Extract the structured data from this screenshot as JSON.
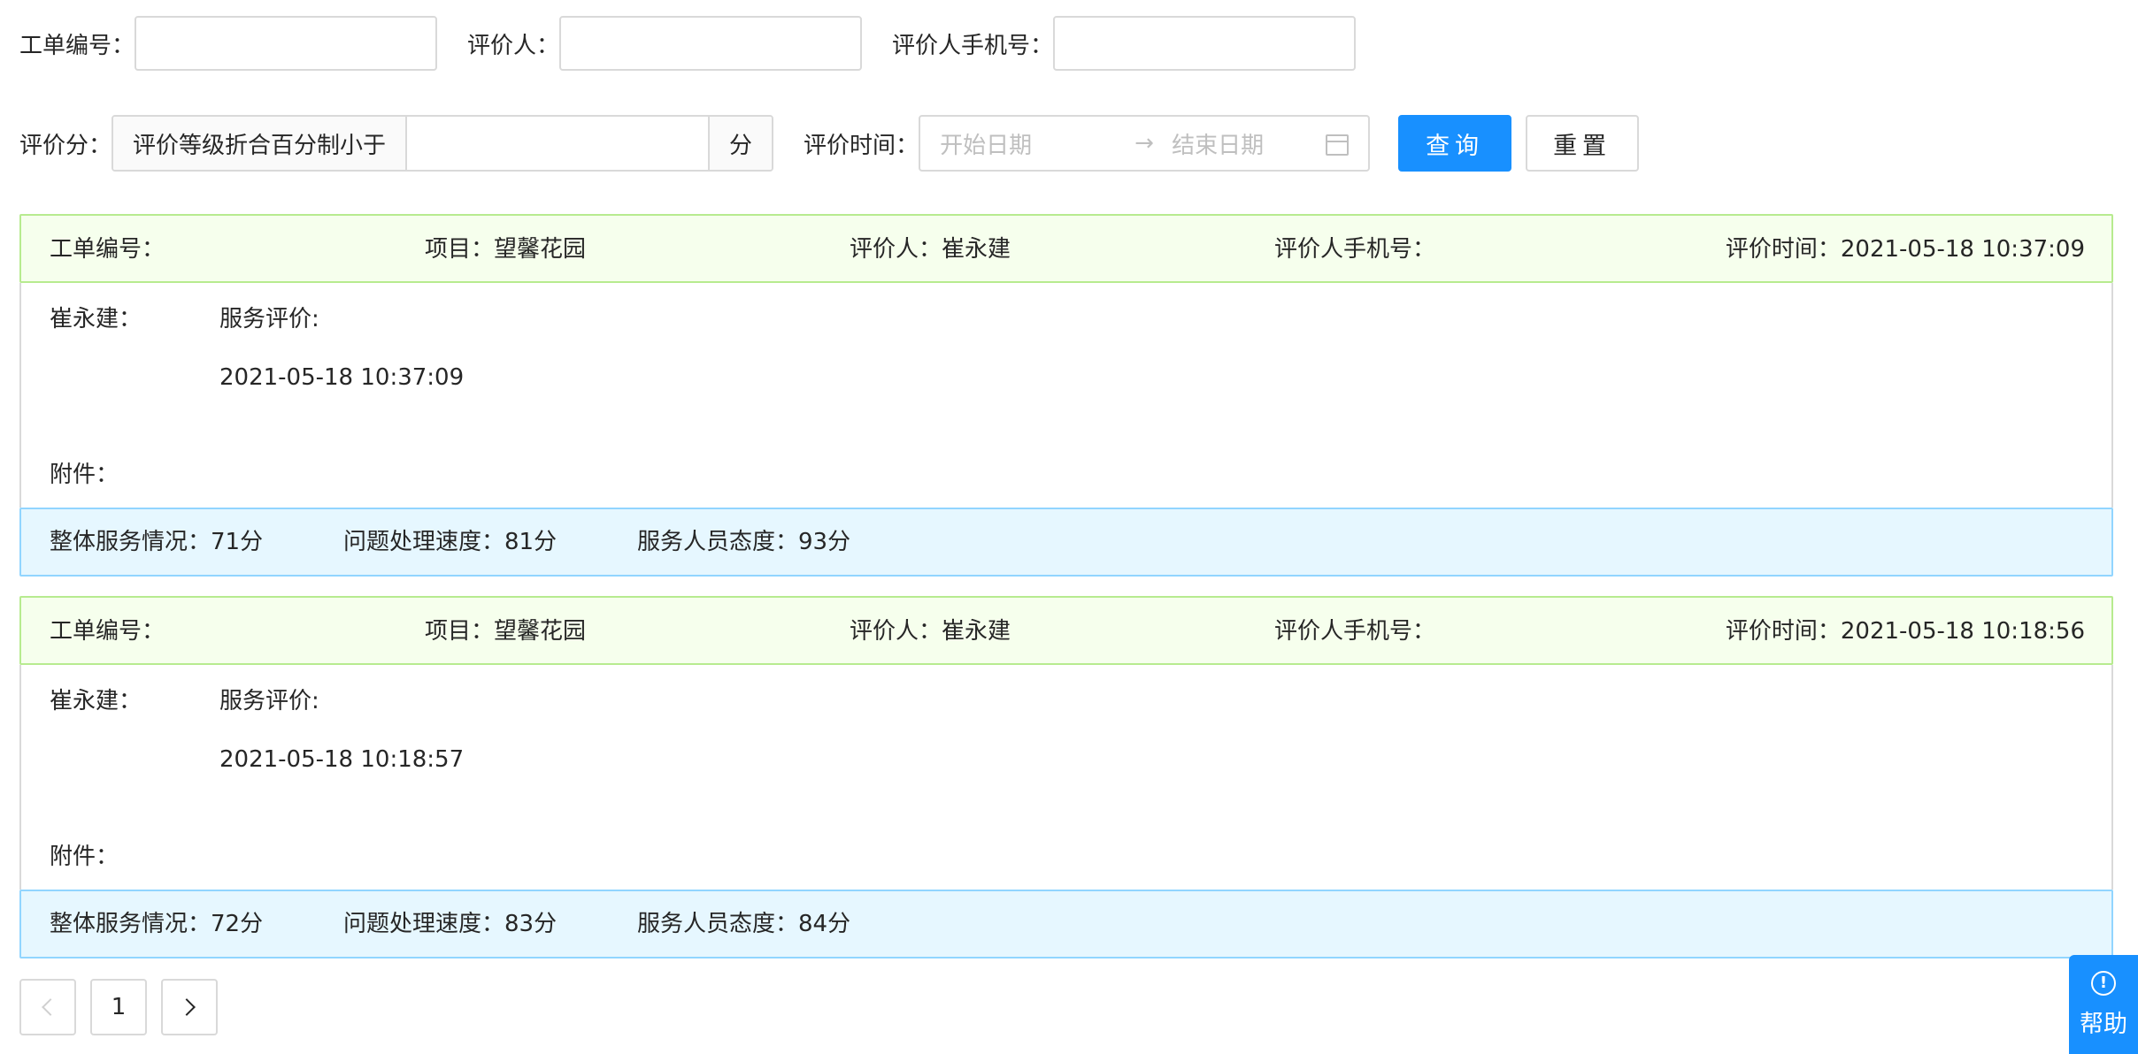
{
  "filters": {
    "order_no_label": "工单编号：",
    "evaluator_label": "评价人：",
    "evaluator_phone_label": "评价人手机号：",
    "score_label": "评价分：",
    "score_prefix": "评价等级折合百分制小于",
    "score_suffix": "分",
    "eval_time_label": "评价时间：",
    "start_date_placeholder": "开始日期",
    "range_arrow": "→",
    "end_date_placeholder": "结束日期",
    "query_button": "查询",
    "reset_button": "重置"
  },
  "labels": {
    "order_no": "工单编号：",
    "project": "项目：",
    "evaluator": "评价人：",
    "evaluator_phone": "评价人手机号：",
    "eval_time": "评价时间：",
    "service_review": "服务评价:",
    "attachment": "附件：",
    "overall_service": "整体服务情况：",
    "processing_speed": "问题处理速度：",
    "staff_attitude": "服务人员态度："
  },
  "reviews": [
    {
      "project": "望馨花园",
      "evaluator": "崔永建",
      "eval_time": "2021-05-18 10:37:09",
      "reviewer_name": "崔永建：",
      "review_time": "2021-05-18 10:37:09",
      "overall_score": "71分",
      "speed_score": "81分",
      "attitude_score": "93分"
    },
    {
      "project": "望馨花园",
      "evaluator": "崔永建",
      "eval_time": "2021-05-18 10:18:56",
      "reviewer_name": "崔永建：",
      "review_time": "2021-05-18 10:18:57",
      "overall_score": "72分",
      "speed_score": "83分",
      "attitude_score": "84分"
    }
  ],
  "pagination": {
    "current_page": "1"
  },
  "help": {
    "label": "帮助",
    "icon_glyph": "!"
  },
  "colors": {
    "primary": "#1890ff",
    "header_bg": "#f6ffed",
    "footer_bg": "#e6f7ff"
  }
}
